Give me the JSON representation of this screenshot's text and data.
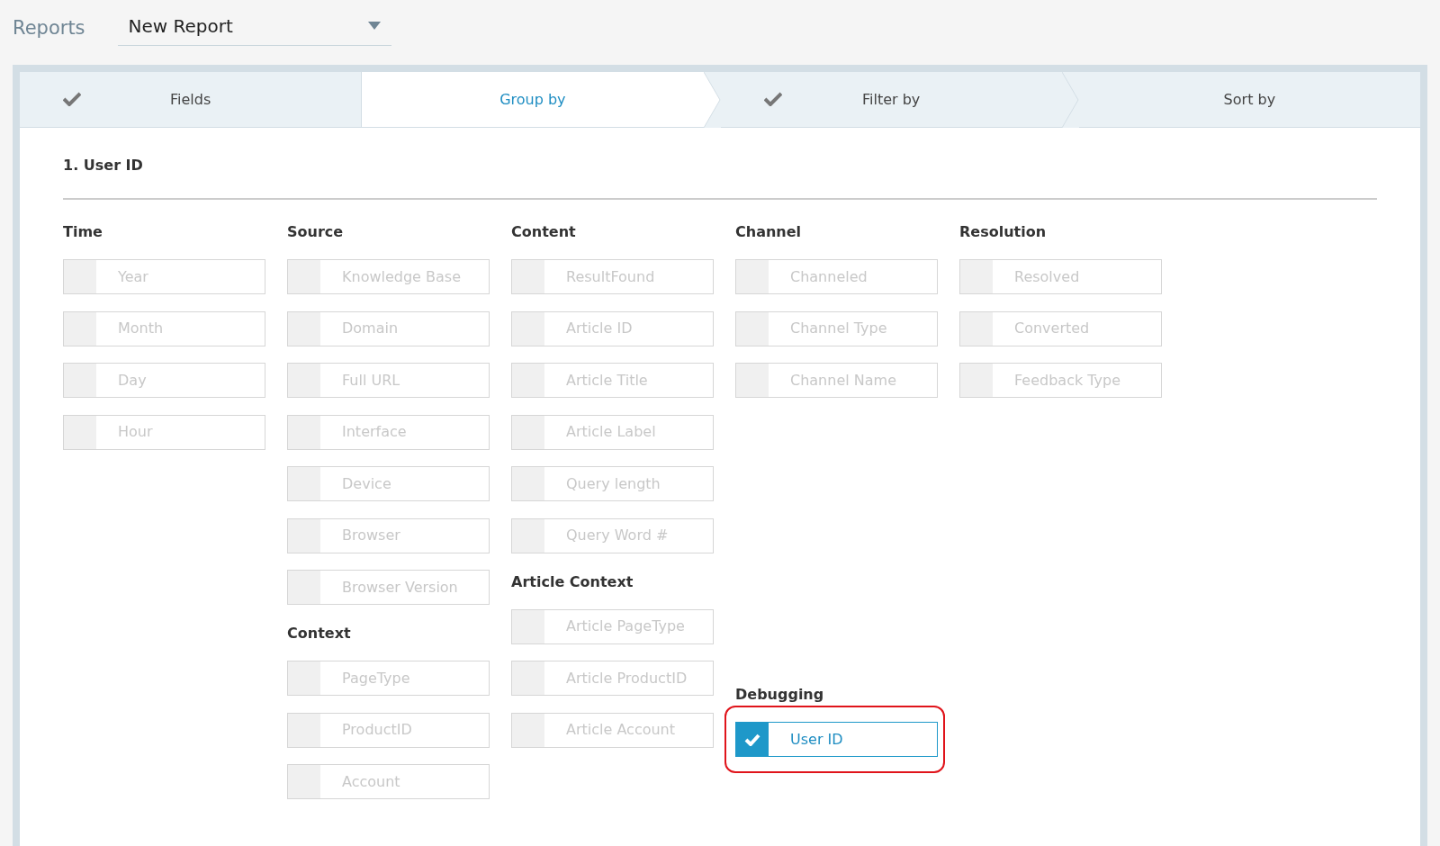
{
  "header": {
    "title": "Reports",
    "report_select": "New Report"
  },
  "tabs": [
    {
      "label": "Fields",
      "done": true,
      "selected": false
    },
    {
      "label": "Group by",
      "done": false,
      "selected": true
    },
    {
      "label": "Filter by",
      "done": true,
      "selected": false
    },
    {
      "label": "Sort by",
      "done": false,
      "selected": false
    }
  ],
  "selection_title": "1. User ID",
  "columns": [
    {
      "groups": [
        {
          "title": "Time",
          "options": [
            {
              "label": "Year",
              "checked": false
            },
            {
              "label": "Month",
              "checked": false
            },
            {
              "label": "Day",
              "checked": false
            },
            {
              "label": "Hour",
              "checked": false
            }
          ]
        }
      ]
    },
    {
      "groups": [
        {
          "title": "Source",
          "options": [
            {
              "label": "Knowledge Base",
              "checked": false
            },
            {
              "label": "Domain",
              "checked": false
            },
            {
              "label": "Full URL",
              "checked": false
            },
            {
              "label": "Interface",
              "checked": false
            },
            {
              "label": "Device",
              "checked": false
            },
            {
              "label": "Browser",
              "checked": false
            },
            {
              "label": "Browser Version",
              "checked": false
            }
          ]
        },
        {
          "title": "Context",
          "options": [
            {
              "label": "PageType",
              "checked": false
            },
            {
              "label": "ProductID",
              "checked": false
            },
            {
              "label": "Account",
              "checked": false
            }
          ]
        }
      ]
    },
    {
      "groups": [
        {
          "title": "Content",
          "options": [
            {
              "label": "ResultFound",
              "checked": false
            },
            {
              "label": "Article ID",
              "checked": false
            },
            {
              "label": "Article Title",
              "checked": false
            },
            {
              "label": "Article Label",
              "checked": false
            },
            {
              "label": "Query length",
              "checked": false
            },
            {
              "label": "Query Word #",
              "checked": false
            }
          ]
        },
        {
          "title": "Article Context",
          "options": [
            {
              "label": "Article PageType",
              "checked": false
            },
            {
              "label": "Article ProductID",
              "checked": false
            },
            {
              "label": "Article Account",
              "checked": false
            }
          ]
        }
      ]
    },
    {
      "groups": [
        {
          "title": "Channel",
          "options": [
            {
              "label": "Channeled",
              "checked": false
            },
            {
              "label": "Channel Type",
              "checked": false
            },
            {
              "label": "Channel Name",
              "checked": false
            }
          ]
        },
        {
          "title": "Debugging",
          "options": [
            {
              "label": "User ID",
              "checked": true,
              "highlighted": true
            }
          ]
        }
      ]
    },
    {
      "groups": [
        {
          "title": "Resolution",
          "options": [
            {
              "label": "Resolved",
              "checked": false
            },
            {
              "label": "Converted",
              "checked": false
            },
            {
              "label": "Feedback Type",
              "checked": false
            }
          ]
        }
      ]
    }
  ]
}
